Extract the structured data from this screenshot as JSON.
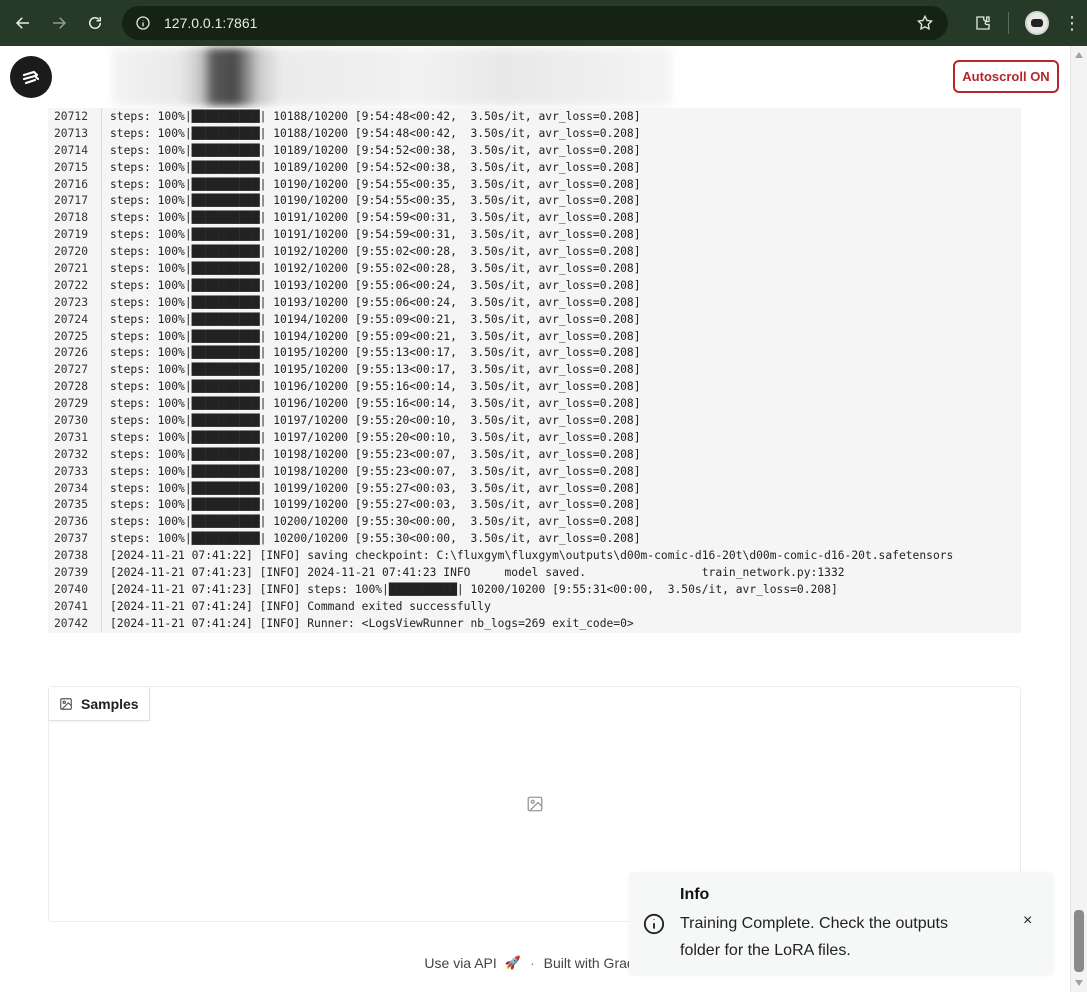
{
  "browser": {
    "url": "127.0.0.1:7861"
  },
  "header": {
    "autoscroll_label": "Autoscroll ON"
  },
  "logs": [
    {
      "n": "20712",
      "t": "steps: 100%|██████████| 10188/10200 [9:54:48<00:42,  3.50s/it, avr_loss=0.208]"
    },
    {
      "n": "20713",
      "t": "steps: 100%|██████████| 10188/10200 [9:54:48<00:42,  3.50s/it, avr_loss=0.208]"
    },
    {
      "n": "20714",
      "t": "steps: 100%|██████████| 10189/10200 [9:54:52<00:38,  3.50s/it, avr_loss=0.208]"
    },
    {
      "n": "20715",
      "t": "steps: 100%|██████████| 10189/10200 [9:54:52<00:38,  3.50s/it, avr_loss=0.208]"
    },
    {
      "n": "20716",
      "t": "steps: 100%|██████████| 10190/10200 [9:54:55<00:35,  3.50s/it, avr_loss=0.208]"
    },
    {
      "n": "20717",
      "t": "steps: 100%|██████████| 10190/10200 [9:54:55<00:35,  3.50s/it, avr_loss=0.208]"
    },
    {
      "n": "20718",
      "t": "steps: 100%|██████████| 10191/10200 [9:54:59<00:31,  3.50s/it, avr_loss=0.208]"
    },
    {
      "n": "20719",
      "t": "steps: 100%|██████████| 10191/10200 [9:54:59<00:31,  3.50s/it, avr_loss=0.208]"
    },
    {
      "n": "20720",
      "t": "steps: 100%|██████████| 10192/10200 [9:55:02<00:28,  3.50s/it, avr_loss=0.208]"
    },
    {
      "n": "20721",
      "t": "steps: 100%|██████████| 10192/10200 [9:55:02<00:28,  3.50s/it, avr_loss=0.208]"
    },
    {
      "n": "20722",
      "t": "steps: 100%|██████████| 10193/10200 [9:55:06<00:24,  3.50s/it, avr_loss=0.208]"
    },
    {
      "n": "20723",
      "t": "steps: 100%|██████████| 10193/10200 [9:55:06<00:24,  3.50s/it, avr_loss=0.208]"
    },
    {
      "n": "20724",
      "t": "steps: 100%|██████████| 10194/10200 [9:55:09<00:21,  3.50s/it, avr_loss=0.208]"
    },
    {
      "n": "20725",
      "t": "steps: 100%|██████████| 10194/10200 [9:55:09<00:21,  3.50s/it, avr_loss=0.208]"
    },
    {
      "n": "20726",
      "t": "steps: 100%|██████████| 10195/10200 [9:55:13<00:17,  3.50s/it, avr_loss=0.208]"
    },
    {
      "n": "20727",
      "t": "steps: 100%|██████████| 10195/10200 [9:55:13<00:17,  3.50s/it, avr_loss=0.208]"
    },
    {
      "n": "20728",
      "t": "steps: 100%|██████████| 10196/10200 [9:55:16<00:14,  3.50s/it, avr_loss=0.208]"
    },
    {
      "n": "20729",
      "t": "steps: 100%|██████████| 10196/10200 [9:55:16<00:14,  3.50s/it, avr_loss=0.208]"
    },
    {
      "n": "20730",
      "t": "steps: 100%|██████████| 10197/10200 [9:55:20<00:10,  3.50s/it, avr_loss=0.208]"
    },
    {
      "n": "20731",
      "t": "steps: 100%|██████████| 10197/10200 [9:55:20<00:10,  3.50s/it, avr_loss=0.208]"
    },
    {
      "n": "20732",
      "t": "steps: 100%|██████████| 10198/10200 [9:55:23<00:07,  3.50s/it, avr_loss=0.208]"
    },
    {
      "n": "20733",
      "t": "steps: 100%|██████████| 10198/10200 [9:55:23<00:07,  3.50s/it, avr_loss=0.208]"
    },
    {
      "n": "20734",
      "t": "steps: 100%|██████████| 10199/10200 [9:55:27<00:03,  3.50s/it, avr_loss=0.208]"
    },
    {
      "n": "20735",
      "t": "steps: 100%|██████████| 10199/10200 [9:55:27<00:03,  3.50s/it, avr_loss=0.208]"
    },
    {
      "n": "20736",
      "t": "steps: 100%|██████████| 10200/10200 [9:55:30<00:00,  3.50s/it, avr_loss=0.208]"
    },
    {
      "n": "20737",
      "t": "steps: 100%|██████████| 10200/10200 [9:55:30<00:00,  3.50s/it, avr_loss=0.208]"
    },
    {
      "n": "20738",
      "t": "[2024-11-21 07:41:22] [INFO] saving checkpoint: C:\\fluxgym\\fluxgym\\outputs\\d00m-comic-d16-20t\\d00m-comic-d16-20t.safetensors"
    },
    {
      "n": "20739",
      "t": "[2024-11-21 07:41:23] [INFO] 2024-11-21 07:41:23 INFO     model saved.                 train_network.py:1332"
    },
    {
      "n": "20740",
      "t": "[2024-11-21 07:41:23] [INFO] steps: 100%|██████████| 10200/10200 [9:55:31<00:00,  3.50s/it, avr_loss=0.208]"
    },
    {
      "n": "20741",
      "t": "[2024-11-21 07:41:24] [INFO] Command exited successfully"
    },
    {
      "n": "20742",
      "t": "[2024-11-21 07:41:24] [INFO] Runner: <LogsViewRunner nb_logs=269 exit_code=0>"
    }
  ],
  "samples": {
    "tab_label": "Samples"
  },
  "footer": {
    "api_label": "Use via API",
    "separator": "·",
    "built_label": "Built with Gradio"
  },
  "toast": {
    "title": "Info",
    "message": "Training Complete. Check the outputs folder for the LoRA files.",
    "close": "×"
  },
  "colors": {
    "chrome_bg": "#273a27",
    "accent_red": "#b4272a",
    "log_bg": "#f5f5f5"
  }
}
